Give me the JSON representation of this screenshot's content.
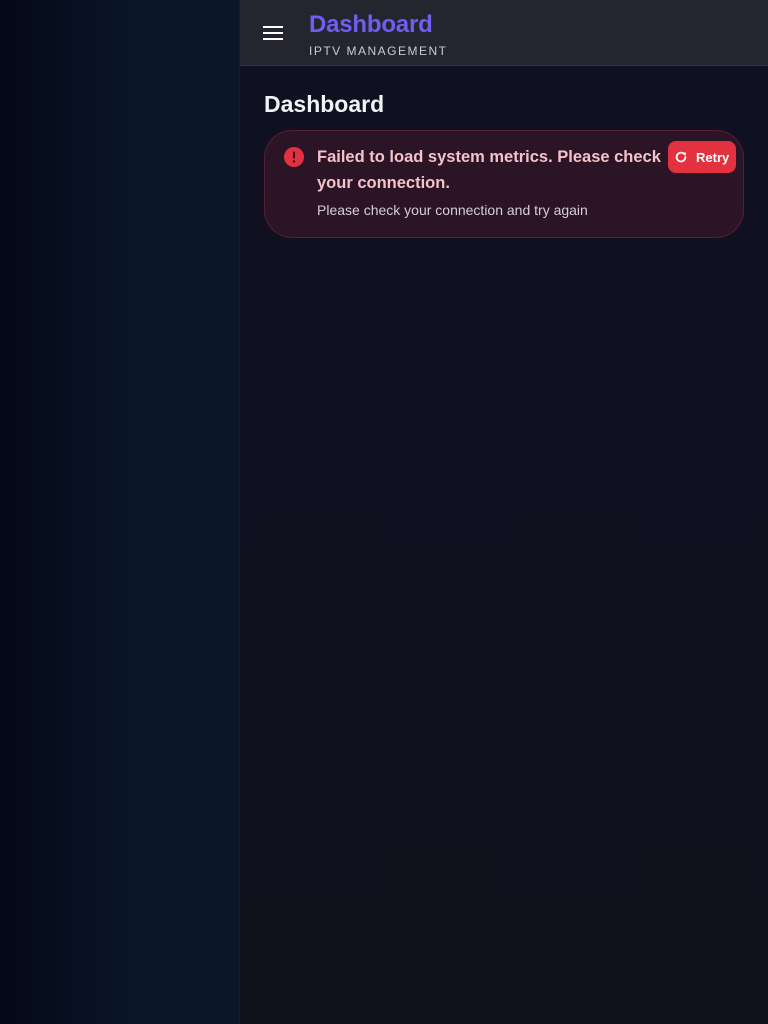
{
  "header": {
    "title": "Dashboard",
    "subtitle": "IPTV MANAGEMENT",
    "menu_icon": "menu-icon"
  },
  "main": {
    "page_title": "Dashboard",
    "alert": {
      "icon": "error-icon",
      "message": "Failed to load system metrics. Please check your connection.",
      "detail": "Please check your connection and try again",
      "retry_label": "Retry",
      "retry_icon": "refresh-icon"
    }
  },
  "colors": {
    "accent": "#6e5ff0",
    "error": "#e3323f",
    "alert_background": "#2a1426",
    "appbar_background": "#25252f"
  }
}
